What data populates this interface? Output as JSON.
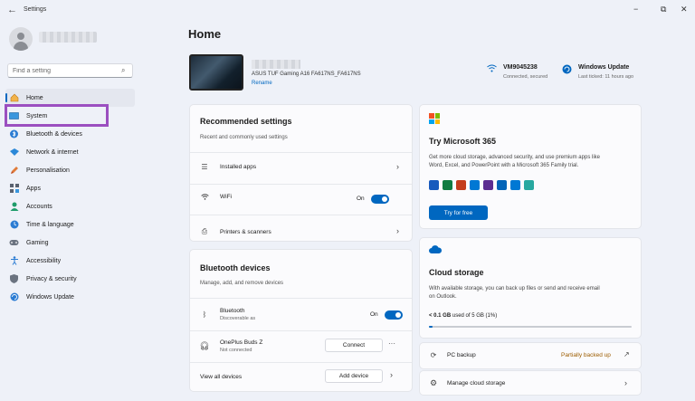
{
  "window": {
    "title": "Settings",
    "back": "←",
    "minimize": "−",
    "maximize": "⧉",
    "close": "✕"
  },
  "search": {
    "placeholder": "Find a setting",
    "icon": "search-icon"
  },
  "sidebar": {
    "items": [
      {
        "label": "Home",
        "icon": "home-icon"
      },
      {
        "label": "System",
        "icon": "system-icon"
      },
      {
        "label": "Bluetooth & devices",
        "icon": "bluetooth-icon"
      },
      {
        "label": "Network & internet",
        "icon": "network-icon"
      },
      {
        "label": "Personalisation",
        "icon": "brush-icon"
      },
      {
        "label": "Apps",
        "icon": "apps-icon"
      },
      {
        "label": "Accounts",
        "icon": "accounts-icon"
      },
      {
        "label": "Time & language",
        "icon": "globe-icon"
      },
      {
        "label": "Gaming",
        "icon": "gaming-icon"
      },
      {
        "label": "Accessibility",
        "icon": "accessibility-icon"
      },
      {
        "label": "Privacy & security",
        "icon": "shield-icon"
      },
      {
        "label": "Windows Update",
        "icon": "update-icon"
      }
    ]
  },
  "home": {
    "title": "Home",
    "device": {
      "name": "ASUS TUF Gaming A16 FA617NS_FA617NS",
      "rename": "Rename"
    },
    "wifi": {
      "title": "VM9045238",
      "sub": "Connected, secured"
    },
    "update": {
      "title": "Windows Update",
      "sub": "Last ticked: 11 hours ago"
    }
  },
  "recommended": {
    "title": "Recommended settings",
    "sub": "Recent and commonly used settings",
    "rows": [
      {
        "label": "Installed apps"
      },
      {
        "label": "WiFi",
        "state": "On"
      },
      {
        "label": "Printers & scanners"
      }
    ]
  },
  "bluetooth": {
    "title": "Bluetooth devices",
    "sub": "Manage, add, and remove devices",
    "bt_label": "Bluetooth",
    "bt_sub": "Discoverable as",
    "bt_state": "On",
    "device_name": "OnePlus Buds Z",
    "device_sub": "Not connected",
    "connect": "Connect",
    "more": "···",
    "view_all": "View all devices",
    "add_device": "Add device"
  },
  "m365": {
    "title": "Try Microsoft 365",
    "desc1": "Get more cloud storage, advanced security, and use premium apps like",
    "desc2": "Word, Excel, and PowerPoint with a Microsoft 365 Family trial.",
    "button": "Try for free",
    "logo_colors": [
      "#f25022",
      "#7fba00",
      "#00a4ef",
      "#ffb900"
    ],
    "app_colors": [
      "#185abd",
      "#107c41",
      "#c43e1c",
      "#0078d4",
      "#5c2d91",
      "#0364b8",
      "#0078d4",
      "#28a8a0"
    ]
  },
  "cloud": {
    "title": "Cloud storage",
    "desc1": "With available storage, you can back up files or send and receive email",
    "desc2": "on Outlook.",
    "used_value": "< 0.1 GB",
    "used_rest": "used of 5 GB (1%)",
    "used_percent": 1,
    "pc_backup": "PC backup",
    "backup_status": "Partially backed up",
    "manage": "Manage cloud storage"
  },
  "colors": {
    "accent": "#0067c0",
    "highlight": "#9b4fc0",
    "warning": "#9d5d00"
  }
}
